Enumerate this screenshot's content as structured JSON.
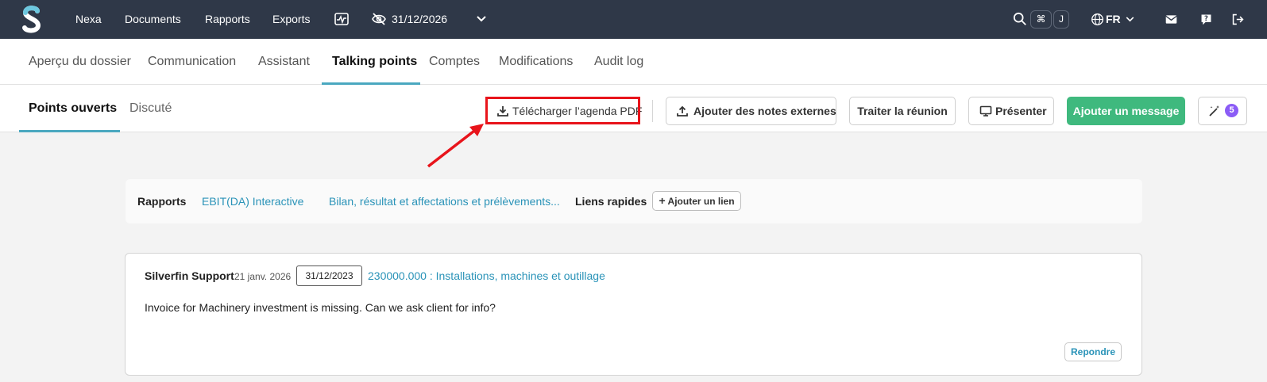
{
  "topbar": {
    "logo_icon": "silverfin-s-logo",
    "items": [
      {
        "label": "Nexa"
      },
      {
        "label": "Documents"
      },
      {
        "label": "Rapports"
      },
      {
        "label": "Exports"
      }
    ],
    "activity_icon": "pulse-monitor-icon",
    "hidden_icon": "eye-slash-icon",
    "period": "31/12/2026",
    "period_chevron_icon": "chevron-down-icon",
    "search_icon": "search-icon",
    "shortcut_keys": [
      "⌘",
      "J"
    ],
    "language": "FR",
    "language_icon": "globe-icon",
    "mail_icon": "envelope-icon",
    "help_icon": "help-icon",
    "logout_icon": "logout-icon"
  },
  "main_tabs": [
    {
      "label": "Aperçu du dossier"
    },
    {
      "label": "Communication"
    },
    {
      "label": "Assistant"
    },
    {
      "label": "Talking points",
      "active": true
    },
    {
      "label": "Comptes"
    },
    {
      "label": "Modifications"
    },
    {
      "label": "Audit log"
    }
  ],
  "sub_tabs": [
    {
      "label": "Points ouverts",
      "active": true
    },
    {
      "label": "Discuté"
    }
  ],
  "actions": {
    "download_pdf": "Télécharger l’agenda PDF",
    "add_external_notes": "Ajouter des notes externes",
    "process_meeting": "Traiter la réunion",
    "present": "Présenter",
    "add_message": "Ajouter un message",
    "magic_count": "5"
  },
  "links_panel": {
    "reports_label": "Rapports",
    "reports": [
      "EBIT(DA) Interactive",
      "Bilan, résultat et affectations et prélèvements..."
    ],
    "quick_links_label": "Liens rapides",
    "add_link": "Ajouter un lien"
  },
  "message": {
    "author": "Silverfin Support",
    "date": "21 janv. 2026",
    "period_badge": "31/12/2023",
    "account": "230000.000 : Installations, machines et outillage",
    "body": "Invoice for Machinery investment is missing. Can we ask client for info?",
    "reply": "Repondre"
  },
  "colors": {
    "navbar": "#2f3848",
    "accent": "#4aa8c0",
    "link": "#2a93b8",
    "green_button": "#3fb97e",
    "highlight": "#e8141b",
    "badge_purple": "#8b5cf6"
  }
}
